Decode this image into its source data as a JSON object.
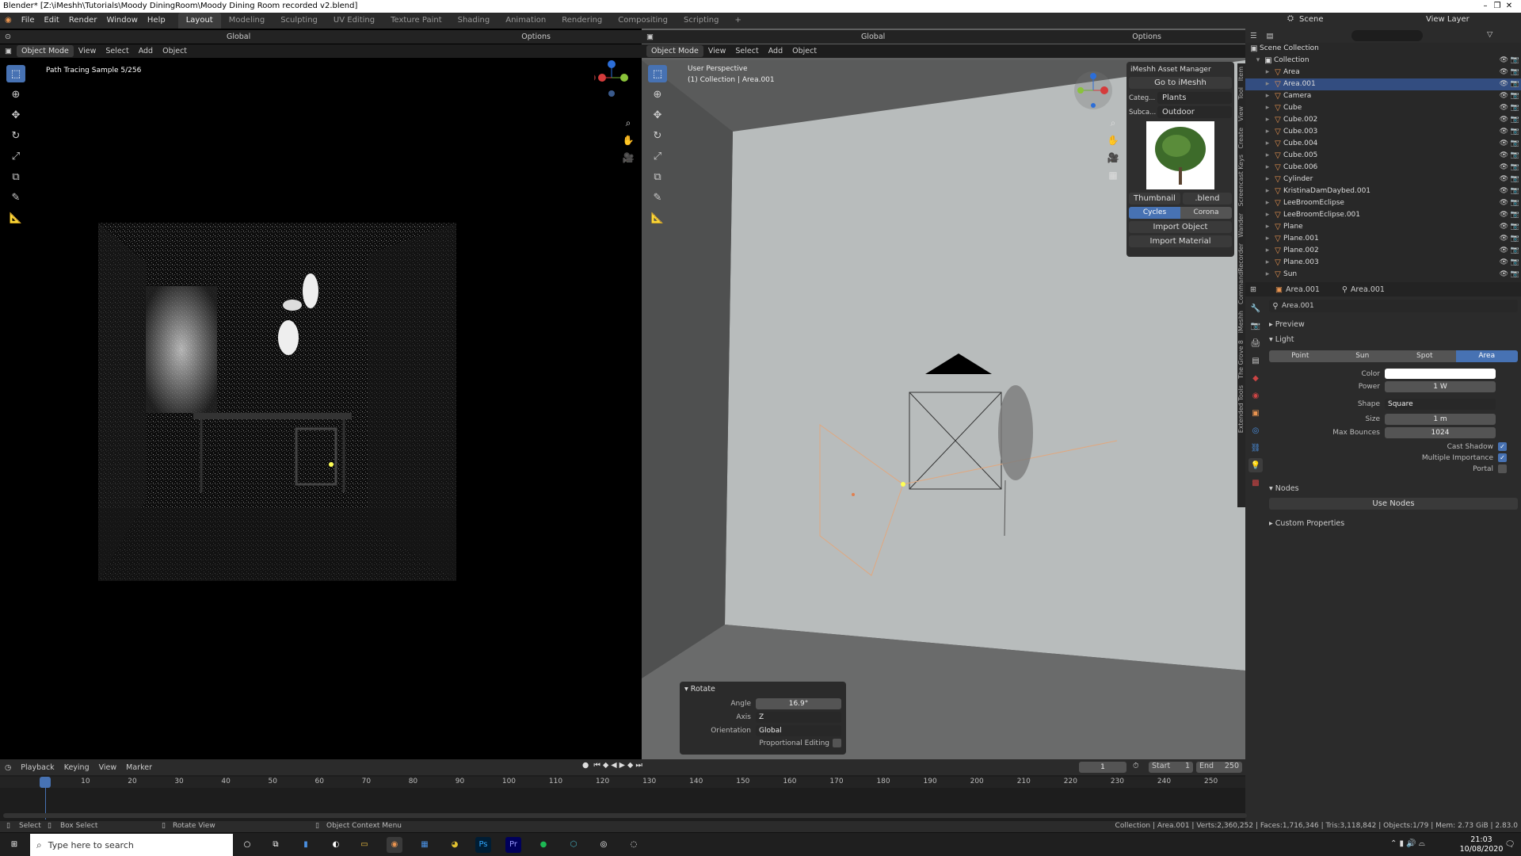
{
  "window": {
    "title": "Blender* [Z:\\iMeshh\\Tutorials\\Moody DiningRoom\\Moody Dining Room recorded v2.blend]"
  },
  "menu": [
    "File",
    "Edit",
    "Render",
    "Window",
    "Help"
  ],
  "workspaces": [
    "Layout",
    "Modeling",
    "Sculpting",
    "UV Editing",
    "Texture Paint",
    "Shading",
    "Animation",
    "Rendering",
    "Compositing",
    "Scripting",
    "+"
  ],
  "left_view": {
    "mode": "Object Mode",
    "menu": [
      "View",
      "Select",
      "Add",
      "Object"
    ],
    "orientation": "Global",
    "options": "Options",
    "overlay_text": "Path Tracing Sample 5/256"
  },
  "right_view": {
    "mode": "Object Mode",
    "menu": [
      "View",
      "Select",
      "Add",
      "Object"
    ],
    "orientation": "Global",
    "options": "Options",
    "perspective": "User Perspective",
    "collection_info": "(1) Collection | Area.001"
  },
  "asset_manager": {
    "title": "iMeshh Asset Manager",
    "goto": "Go to iMeshh",
    "category_label": "Categ...",
    "category": "Plants",
    "subcategory_label": "Subca...",
    "subcategory": "Outdoor",
    "thumbnail": "Thumbnail",
    "blend": ".blend",
    "engines": [
      "Cycles",
      "Corona"
    ],
    "import_object": "Import Object",
    "import_material": "Import Material"
  },
  "side_tabs": [
    "Item",
    "Tool",
    "View",
    "Create",
    "Screencast Keys",
    "Wander",
    "CommandRecorder",
    "iMeshh",
    "The Grove 8",
    "Extended Tools"
  ],
  "rotate_panel": {
    "title": "Rotate",
    "angle_label": "Angle",
    "angle": "16.9°",
    "axis_label": "Axis",
    "axis": "Z",
    "orientation_label": "Orientation",
    "orientation": "Global",
    "prop_editing": "Proportional Editing"
  },
  "top_right": {
    "scene": "Scene",
    "view_layer": "View Layer"
  },
  "outliner": {
    "root": "Scene Collection",
    "collection": "Collection",
    "items": [
      "Area",
      "Area.001",
      "Camera",
      "Cube",
      "Cube.002",
      "Cube.003",
      "Cube.004",
      "Cube.005",
      "Cube.006",
      "Cylinder",
      "KristinaDamDaybed.001",
      "LeeBroomEclipse",
      "LeeBroomEclipse.001",
      "Plane",
      "Plane.001",
      "Plane.002",
      "Plane.003",
      "Sun"
    ],
    "selected": "Area.001"
  },
  "properties": {
    "object": "Area.001",
    "data": "Area.001",
    "datablock": "Area.001",
    "preview": "Preview",
    "light": "Light",
    "light_types": [
      "Point",
      "Sun",
      "Spot",
      "Area"
    ],
    "active_type": "Area",
    "color_label": "Color",
    "color": "#ffffff",
    "power_label": "Power",
    "power": "1 W",
    "shape_label": "Shape",
    "shape": "Square",
    "size_label": "Size",
    "size": "1 m",
    "bounces_label": "Max Bounces",
    "bounces": "1024",
    "cast_shadow": "Cast Shadow",
    "mis": "Multiple Importance",
    "portal": "Portal",
    "nodes": "Nodes",
    "use_nodes": "Use Nodes",
    "custom": "Custom Properties"
  },
  "timeline": {
    "menu": [
      "Playback",
      "Keying",
      "View",
      "Marker"
    ],
    "current": "1",
    "start_label": "Start",
    "start": "1",
    "end_label": "End",
    "end": "250",
    "ticks": [
      "1",
      "10",
      "20",
      "30",
      "40",
      "50",
      "60",
      "70",
      "80",
      "90",
      "100",
      "110",
      "120",
      "130",
      "140",
      "150",
      "160",
      "170",
      "180",
      "190",
      "200",
      "210",
      "220",
      "230",
      "240",
      "250"
    ]
  },
  "statusbar": {
    "select": "Select",
    "box_select": "Box Select",
    "rotate_view": "Rotate View",
    "context_menu": "Object Context Menu",
    "stats": "Collection | Area.001 | Verts:2,360,252 | Faces:1,716,346 | Tris:3,118,842 | Objects:1/79 | Mem: 2.73 GiB | 2.83.0"
  },
  "taskbar": {
    "search": "Type here to search",
    "time": "21:03",
    "date": "10/08/2020"
  },
  "colors": {
    "accent": "#4772b3",
    "selected_row": "#334d80",
    "object_orange": "#e99450"
  }
}
